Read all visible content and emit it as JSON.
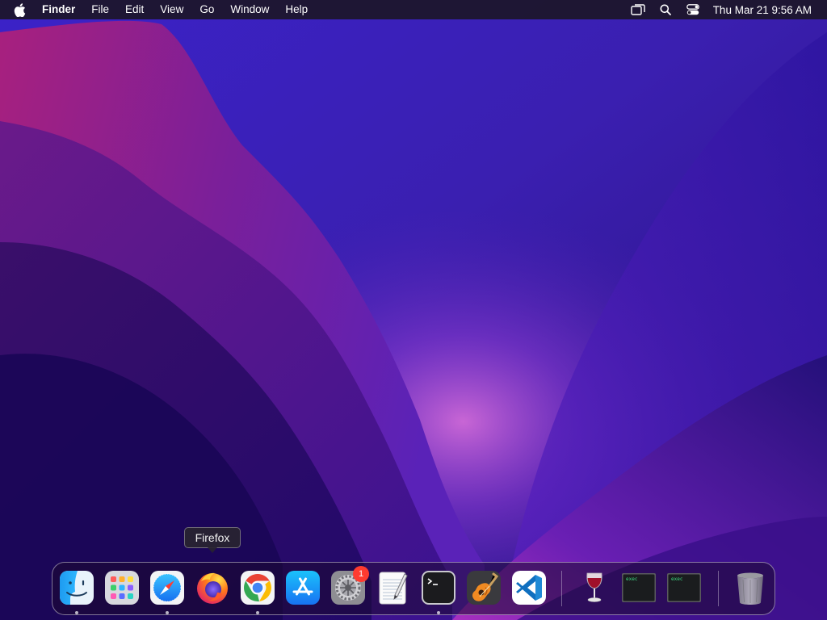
{
  "menubar": {
    "app_name": "Finder",
    "items": [
      "File",
      "Edit",
      "View",
      "Go",
      "Window",
      "Help"
    ],
    "clock": "Thu Mar 21  9:56 AM",
    "status_icons": [
      "screen-mirroring-icon",
      "spotlight-search-icon",
      "control-center-icon"
    ]
  },
  "tooltip": {
    "label": "Firefox"
  },
  "dock": {
    "apps": [
      {
        "name": "Finder",
        "icon": "finder-icon",
        "running": true
      },
      {
        "name": "Launchpad",
        "icon": "launchpad-icon",
        "running": false
      },
      {
        "name": "Safari",
        "icon": "safari-icon",
        "running": true
      },
      {
        "name": "Firefox",
        "icon": "firefox-icon",
        "running": false
      },
      {
        "name": "Google Chrome",
        "icon": "chrome-icon",
        "running": true
      },
      {
        "name": "App Store",
        "icon": "app-store-icon",
        "running": false
      },
      {
        "name": "System Preferences",
        "icon": "system-preferences-icon",
        "running": false,
        "badge": "1"
      },
      {
        "name": "TextEdit",
        "icon": "textedit-icon",
        "running": false
      },
      {
        "name": "Terminal",
        "icon": "terminal-icon",
        "running": true
      },
      {
        "name": "GarageBand",
        "icon": "garageband-icon",
        "running": false
      },
      {
        "name": "Visual Studio Code",
        "icon": "vscode-icon",
        "running": false
      }
    ],
    "others": [
      {
        "name": "Wine",
        "icon": "wine-icon"
      },
      {
        "name": "exec",
        "icon": "exec-file-icon",
        "label": "exec"
      },
      {
        "name": "exec",
        "icon": "exec-file-icon",
        "label": "exec"
      }
    ],
    "trash": {
      "name": "Trash",
      "icon": "trash-icon"
    }
  },
  "colors": {
    "wallpaper_deep": "#1a0b4a",
    "wallpaper_magenta": "#c02a9a",
    "wallpaper_blue": "#3a2fd6"
  }
}
